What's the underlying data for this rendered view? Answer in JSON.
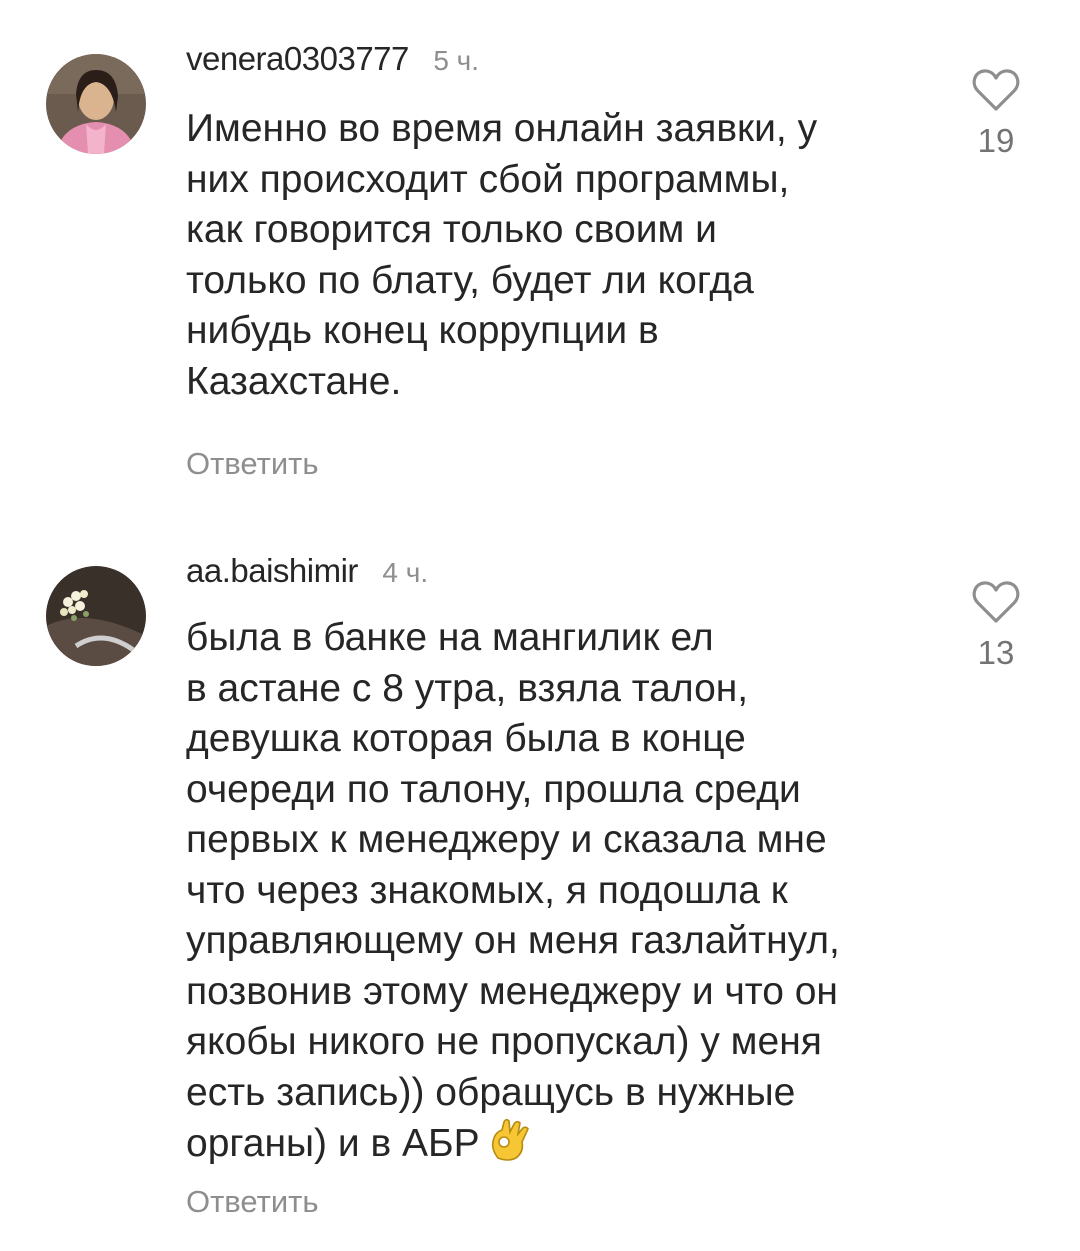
{
  "comments": [
    {
      "username": "venera0303777",
      "time": "5 ч.",
      "text": "Именно во время онлайн заявки, у\nних происходит сбой программы,\nкак говорится только своим и\nтолько по блату, будет ли когда\nнибудь конец коррупции в\nКазахстане.",
      "reply_label": "Ответить",
      "likes": "19",
      "avatar_icon": "user-photo-avatar"
    },
    {
      "username": "aa.baishimir",
      "time": "4 ч.",
      "text": "была в банке на мангилик ел\nв астане с 8 утра, взяла талон,\nдевушка которая была в конце\nочереди по талону, прошла среди\nпервых к менеджеру и сказала мне\nчто через знакомых, я подошла к\nуправляющему он меня газлайтнул,\nпозвонив этому менеджеру и что он\nякобы никого не пропускал) у меня\nесть запись)) обращусь в нужные\nорганы) и в АБР",
      "emoji": "ok-hand-emoji",
      "reply_label": "Ответить",
      "likes": "13",
      "avatar_icon": "flowers-photo-avatar"
    }
  ],
  "colors": {
    "text": "#262626",
    "secondary": "#8e8e8e",
    "heart_outline": "#8e8e8e"
  }
}
